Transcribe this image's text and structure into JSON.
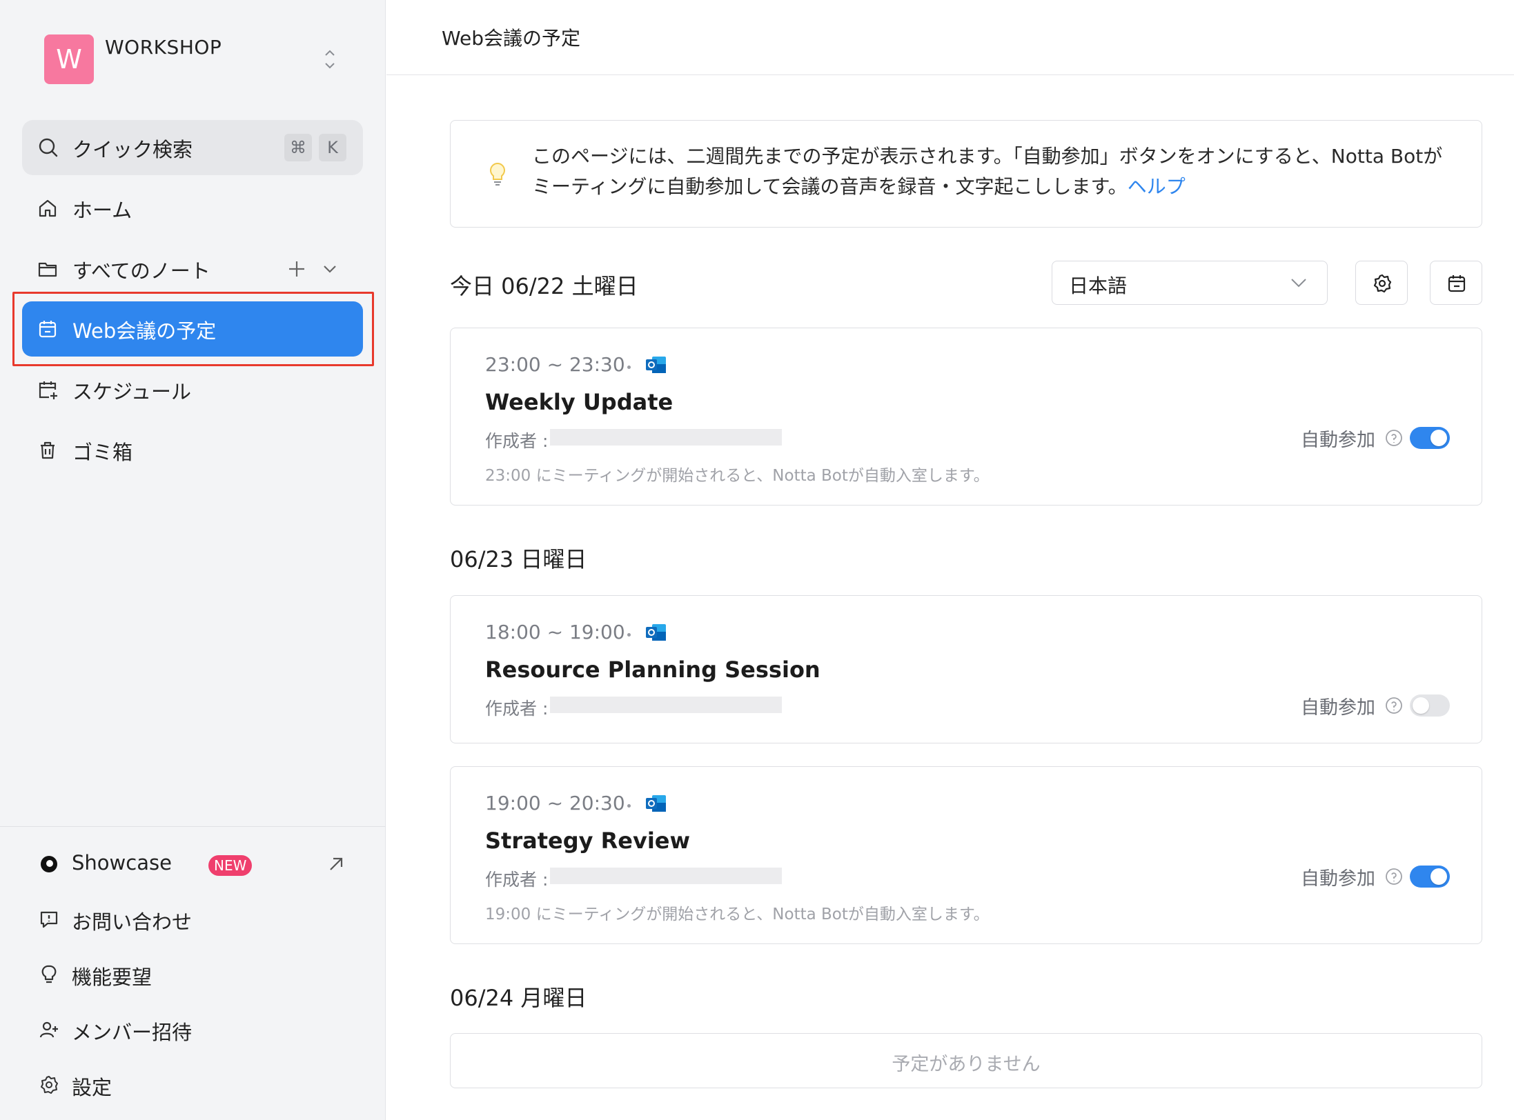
{
  "workspace": {
    "initial": "W",
    "name": "WORKSHOP"
  },
  "search": {
    "label": "クイック検索",
    "key1": "⌘",
    "key2": "K"
  },
  "nav": {
    "home": "ホーム",
    "all_notes": "すべてのノート",
    "meetings": "Web会議の予定",
    "schedule": "スケジュール",
    "trash": "ゴミ箱"
  },
  "bottom_nav": {
    "showcase": "Showcase",
    "showcase_badge": "NEW",
    "contact": "お問い合わせ",
    "feature_request": "機能要望",
    "invite": "メンバー招待",
    "settings": "設定"
  },
  "header": {
    "title": "Web会議の予定"
  },
  "info": {
    "line1": "このページには、二週間先までの予定が表示されます。「自動参加」ボタンをオンにすると、Notta Botが",
    "line2": "ミーティングに自動参加して会議の音声を録音・文字起こしします。",
    "link": "ヘルプ"
  },
  "controls": {
    "language": "日本語"
  },
  "days": [
    {
      "heading": "今日 06/22 土曜日"
    },
    {
      "heading": "06/23 日曜日"
    },
    {
      "heading": "06/24 月曜日",
      "empty_label": "予定がありません"
    }
  ],
  "events": [
    {
      "time": "23:00 ~ 23:30",
      "name": "Weekly Update",
      "creator_label": "作成者 :",
      "note": "23:00 にミーティングが開始されると、Notta Botが自動入室します。",
      "auto_join_label": "自動参加",
      "auto_join": true
    },
    {
      "time": "18:00 ~ 19:00",
      "name": "Resource Planning Session",
      "creator_label": "作成者 :",
      "note": "",
      "auto_join_label": "自動参加",
      "auto_join": false
    },
    {
      "time": "19:00 ~ 20:30",
      "name": "Strategy Review",
      "creator_label": "作成者 :",
      "note": "19:00 にミーティングが開始されると、Notta Botが自動入室します。",
      "auto_join_label": "自動参加",
      "auto_join": true
    }
  ],
  "colors": {
    "accent": "#2f86ee",
    "highlight": "#e8392c",
    "avatar": "#f7789f",
    "badge": "#ef3f6d"
  },
  "icons": {
    "search": "search-icon",
    "home": "home-icon",
    "folder": "folder-icon",
    "calendar": "calendar-icon",
    "schedule": "calendar-edit-icon",
    "trash": "trash-icon",
    "showcase": "showcase-logo-icon",
    "contact": "message-alert-icon",
    "feature": "lightbulb-icon",
    "invite": "user-plus-icon",
    "settings": "gear-icon",
    "outlook": "outlook-icon",
    "help": "question-circle-icon"
  }
}
